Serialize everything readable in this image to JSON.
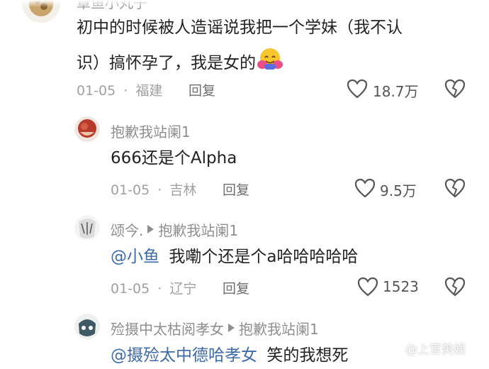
{
  "top_comment": {
    "username_partial": "章鱼小丸子",
    "text_line1": "初中的时候被人造谣说我把一个学妹（我不认",
    "text_line2": "识）搞怀孕了，我是女的",
    "emoji": "hugging-face",
    "date": "01-05",
    "location": "福建",
    "reply_label": "回复",
    "likes": "18.7万"
  },
  "reply1": {
    "username": "抱歉我站阑1",
    "text": "666还是个Alpha",
    "date": "01-05",
    "location": "吉林",
    "reply_label": "回复",
    "likes": "9.5万"
  },
  "reply2": {
    "username": "颂今.",
    "reply_to": "抱歉我站阑1",
    "mention": "@小鱼",
    "text": "我嘞个还是个a哈哈哈哈哈",
    "date": "01-05",
    "location": "辽宁",
    "reply_label": "回复",
    "likes": "1523"
  },
  "reply3": {
    "username": "殓摄中太枯阅孝女",
    "reply_to": "抱歉我站阑1",
    "mention": "@摄殓太中德哈孝女",
    "text": "笑的我想死"
  },
  "watermark": "@上官美娱",
  "colors": {
    "mention": "#3e6aa7",
    "meta": "#a0a0a0",
    "name": "#8e8e8e"
  }
}
